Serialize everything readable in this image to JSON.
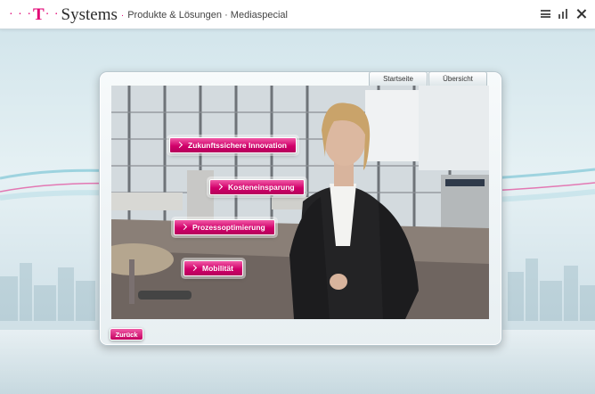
{
  "header": {
    "logo_dots": "· · ·",
    "logo_t": "T",
    "logo_sep_dots": "· ·",
    "logo_systems": "Systems",
    "logo_dot": "·",
    "subtitle": "Produkte & Lösungen · Mediaspecial",
    "icons": [
      "menu-icon",
      "chart-icon",
      "close-icon"
    ]
  },
  "tabs": [
    {
      "label": "Startseite"
    },
    {
      "label": "Übersicht"
    }
  ],
  "hotspots": [
    {
      "label": "Zukunftssichere Innovation"
    },
    {
      "label": "Kosteneinsparung"
    },
    {
      "label": "Prozessoptimierung"
    },
    {
      "label": "Mobilität"
    }
  ],
  "back_button": {
    "label": "Zurück"
  },
  "colors": {
    "brand_magenta": "#e20074",
    "button_pink": "#d1006a",
    "background": "#dceaef"
  }
}
